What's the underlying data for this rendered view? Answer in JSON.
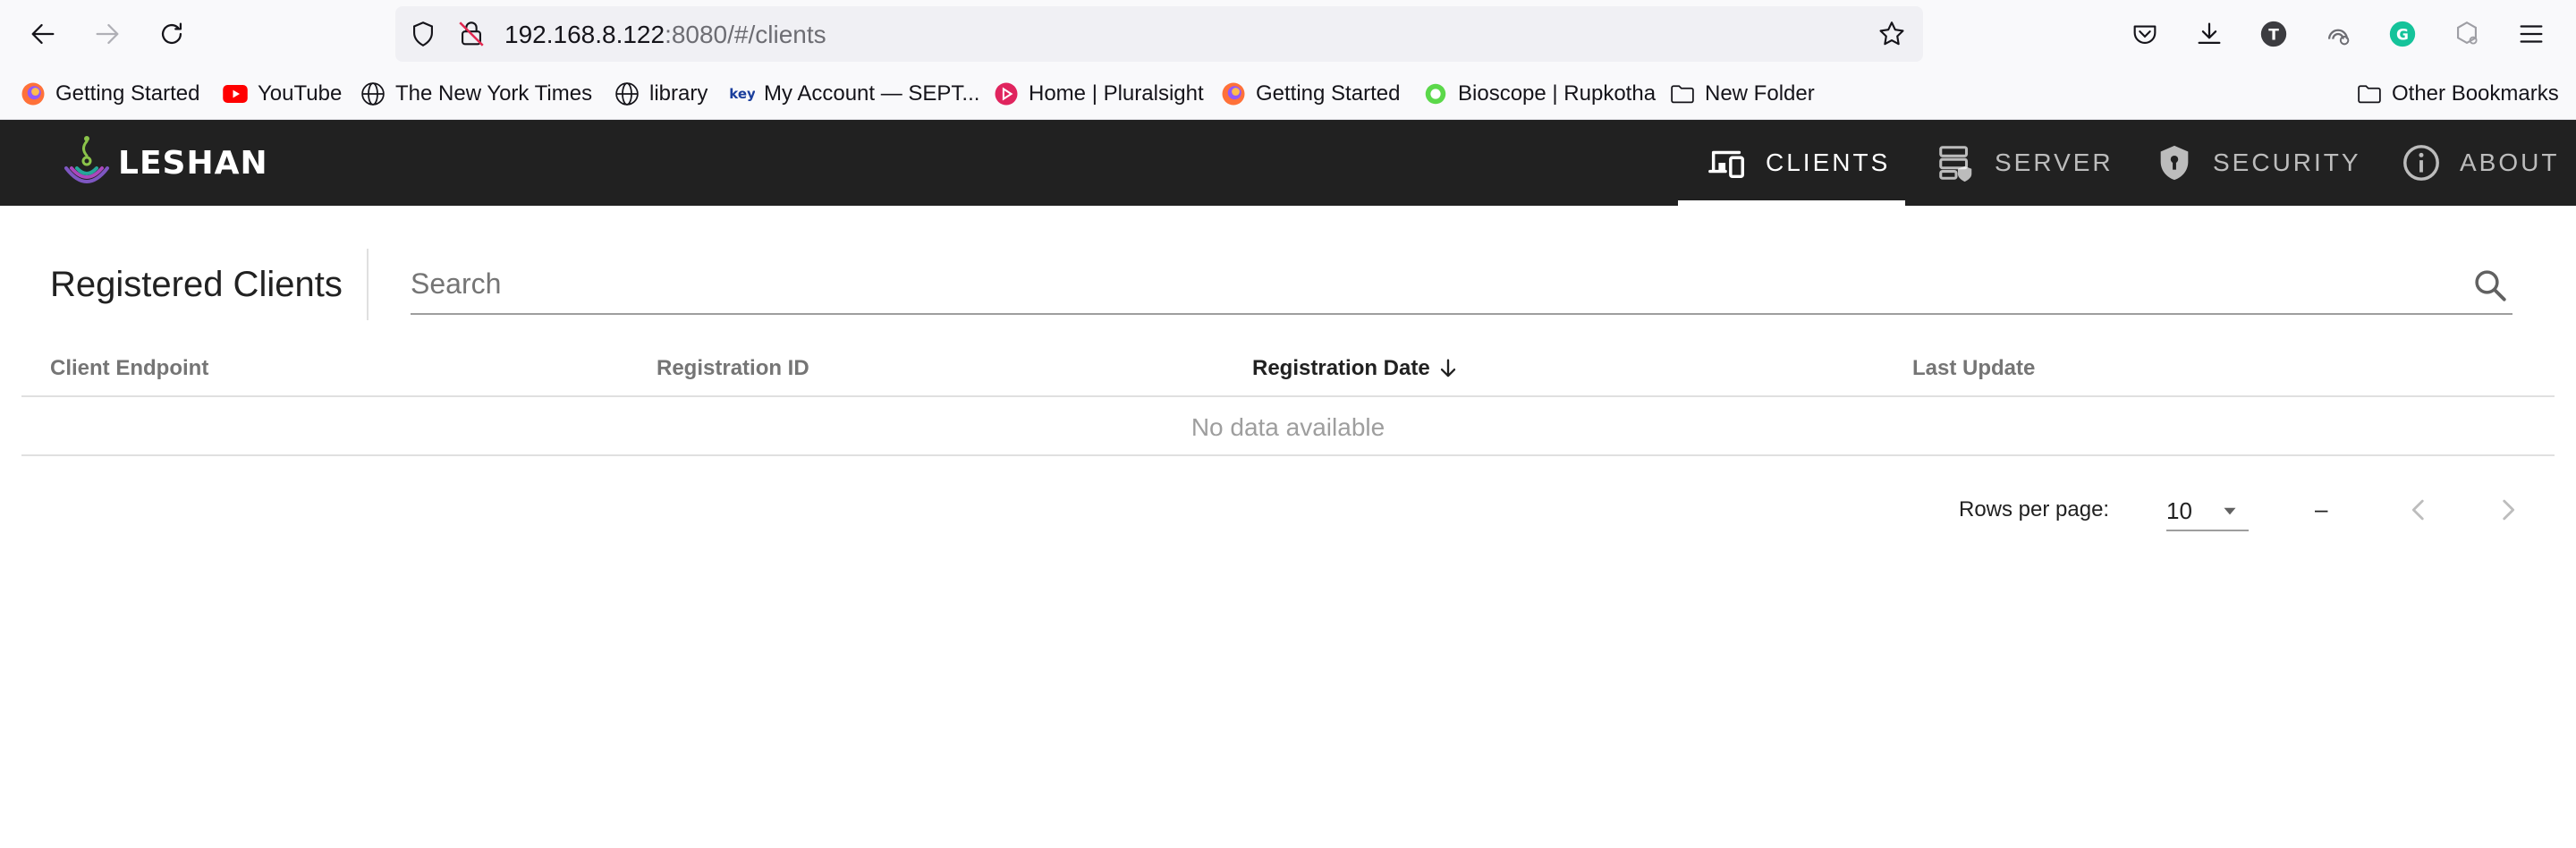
{
  "browser": {
    "url_host": "192.168.8.122",
    "url_rest": ":8080/#/clients",
    "profile_initial": "T",
    "extension_initial": "G"
  },
  "bookmarks": [
    {
      "label": "Getting Started",
      "icon": "firefox-icon"
    },
    {
      "label": "YouTube",
      "icon": "youtube-icon"
    },
    {
      "label": "The New York Times",
      "icon": "globe-icon"
    },
    {
      "label": "library",
      "icon": "globe-icon"
    },
    {
      "label": "My Account — SEPT...",
      "icon": "key-icon"
    },
    {
      "label": "Home | Pluralsight",
      "icon": "pluralsight-icon"
    },
    {
      "label": "Getting Started",
      "icon": "firefox-icon"
    },
    {
      "label": "Bioscope | Rupkotha",
      "icon": "circle-icon"
    },
    {
      "label": "New Folder",
      "icon": "folder-icon"
    }
  ],
  "other_bookmarks": "Other Bookmarks",
  "app": {
    "logo_text": "LESHAN",
    "nav": [
      {
        "label": "CLIENTS",
        "icon": "devices-icon",
        "active": true
      },
      {
        "label": "SERVER",
        "icon": "server-icon",
        "active": false
      },
      {
        "label": "SECURITY",
        "icon": "shield-icon",
        "active": false
      },
      {
        "label": "ABOUT",
        "icon": "info-icon",
        "active": false
      }
    ]
  },
  "main": {
    "title": "Registered Clients",
    "search_placeholder": "Search",
    "columns": [
      "Client Endpoint",
      "Registration ID",
      "Registration Date",
      "Last Update"
    ],
    "sorted_column": "Registration Date",
    "empty_text": "No data available",
    "rows_per_page_label": "Rows per page:",
    "rows_per_page_value": "10",
    "range_text": "–"
  },
  "colors": {
    "appbar": "#212121",
    "accent": "#ffffff",
    "youtube": "#ff0000",
    "pluralsight": "#e0245e"
  }
}
